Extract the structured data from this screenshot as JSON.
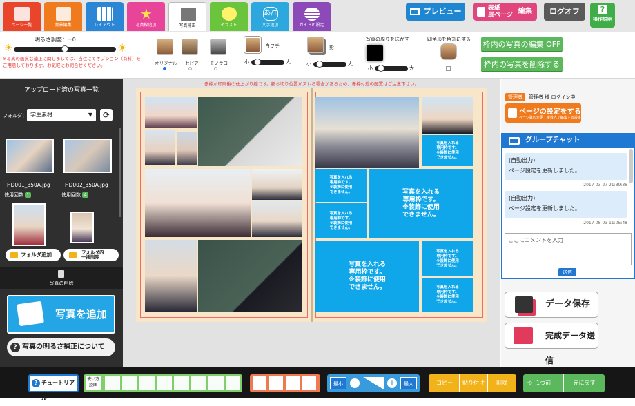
{
  "tabs": [
    {
      "label": "ページ一覧",
      "color": "#e8452b"
    },
    {
      "label": "背景編集",
      "color": "#f07a1e"
    },
    {
      "label": "レイアウト",
      "color": "#2b86d6"
    },
    {
      "label": "写真枠追加",
      "color": "#e8459a"
    },
    {
      "label": "写真補正",
      "color": "#ffffff"
    },
    {
      "label": "イラスト",
      "color": "#6ac43c"
    },
    {
      "label": "文字追加",
      "color": "#2ca8de"
    },
    {
      "label": "ガイドの設定",
      "color": "#8b4ab8"
    }
  ],
  "topbar": {
    "preview": "プレビュー",
    "cover_line1": "表紙",
    "cover_line2": "扉ページ",
    "edit": "編集",
    "logoff": "ログオフ",
    "manual": "操作説明"
  },
  "brightness": {
    "label": "明るさ調整：±0",
    "notice": "※写真の画質な補正に関しましては、当社にてオプション（有料）をご用意しております。お気軽にお問合せください。",
    "value": 0.5
  },
  "filters": {
    "original": "オリジナル",
    "sepia": "セピア",
    "mono": "モノクロ"
  },
  "border": {
    "white_label": "白フチ",
    "shadow_label": "影",
    "small": "小",
    "large": "大",
    "white_value": 0.1,
    "shadow_value": 0.1
  },
  "blur": {
    "label": "写真の周りをぼかす",
    "small": "小",
    "large": "大",
    "value": 0.1
  },
  "rounded": {
    "label": "四角形を角丸にする"
  },
  "frame_actions": {
    "edit_off": "枠内の写真の編集 OFF",
    "delete": "枠内の写真を削除する"
  },
  "left_panel": {
    "title": "アップロード済の写真一覧",
    "folder_label": "フォルダ：",
    "folder_value": "学生素材",
    "photos": [
      {
        "name": "HD001_350A.jpg",
        "usage_label": "使用回数",
        "count": "1"
      },
      {
        "name": "HD002_350A.jpg",
        "usage_label": "使用回数",
        "count": "4"
      }
    ],
    "add_folder": "フォルダ追加",
    "delete_all_line1": "フォルダ内",
    "delete_all_line2": "一括削除",
    "delete_photo": "写真の削除",
    "add_photo": "写真を追加",
    "brightness_help": "写真の明るさ補正について"
  },
  "book": {
    "warning": "赤枠が印刷後の仕上がり線です。断ち切り位置がズレる場合があるため、赤枠付近の配置はご注意下さい。",
    "placeholder_small": "写真を入れる\n専用枠です。\n※装飾に使用\nできません。",
    "placeholder_large": "写真を入れる\n専用枠です。\n※装飾に使用\nできません。"
  },
  "right_panel": {
    "admin_badge": "管理者",
    "login_text": "管理者 様 ログイン中",
    "page_settings": "ページの設定をする",
    "page_settings_sub": "ページ数の変更・複数人で編集する設定",
    "chat_title": "グループチャット",
    "messages": [
      {
        "author": "(自動出力)",
        "text": "ページ設定を更新しました。",
        "time": "2017-03-27 21:39:36"
      },
      {
        "author": "(自動出力)",
        "text": "ページ設定を更新しました。",
        "time": "2017-08-03 11:05:48"
      }
    ],
    "comment_placeholder": "ここにコメントを入力",
    "send": "送信",
    "save": "データ保存",
    "submit": "完成データ送信"
  },
  "bottombar": {
    "tutorial": "チュートリアル",
    "usage_line1": "使い方",
    "usage_line2": "説明",
    "min": "最小",
    "max": "最大",
    "copy": "コピー",
    "paste": "貼り付け",
    "delete": "削除",
    "undo": "1つ前",
    "redo": "元に戻す"
  }
}
